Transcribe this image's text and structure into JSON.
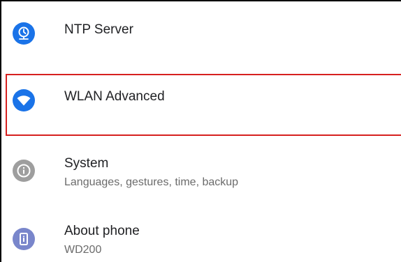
{
  "settings": {
    "items": [
      {
        "title": "NTP Server",
        "subtitle": "",
        "icon": "ntp-icon",
        "color": "#1a73e8"
      },
      {
        "title": "WLAN Advanced",
        "subtitle": "",
        "icon": "wifi-icon",
        "color": "#1a73e8"
      },
      {
        "title": "System",
        "subtitle": "Languages, gestures, time, backup",
        "icon": "info-icon",
        "color": "#9e9e9e"
      },
      {
        "title": "About phone",
        "subtitle": "WD200",
        "icon": "phone-icon",
        "color": "#7986cb"
      }
    ]
  },
  "highlight": {
    "color": "#d6201f"
  }
}
